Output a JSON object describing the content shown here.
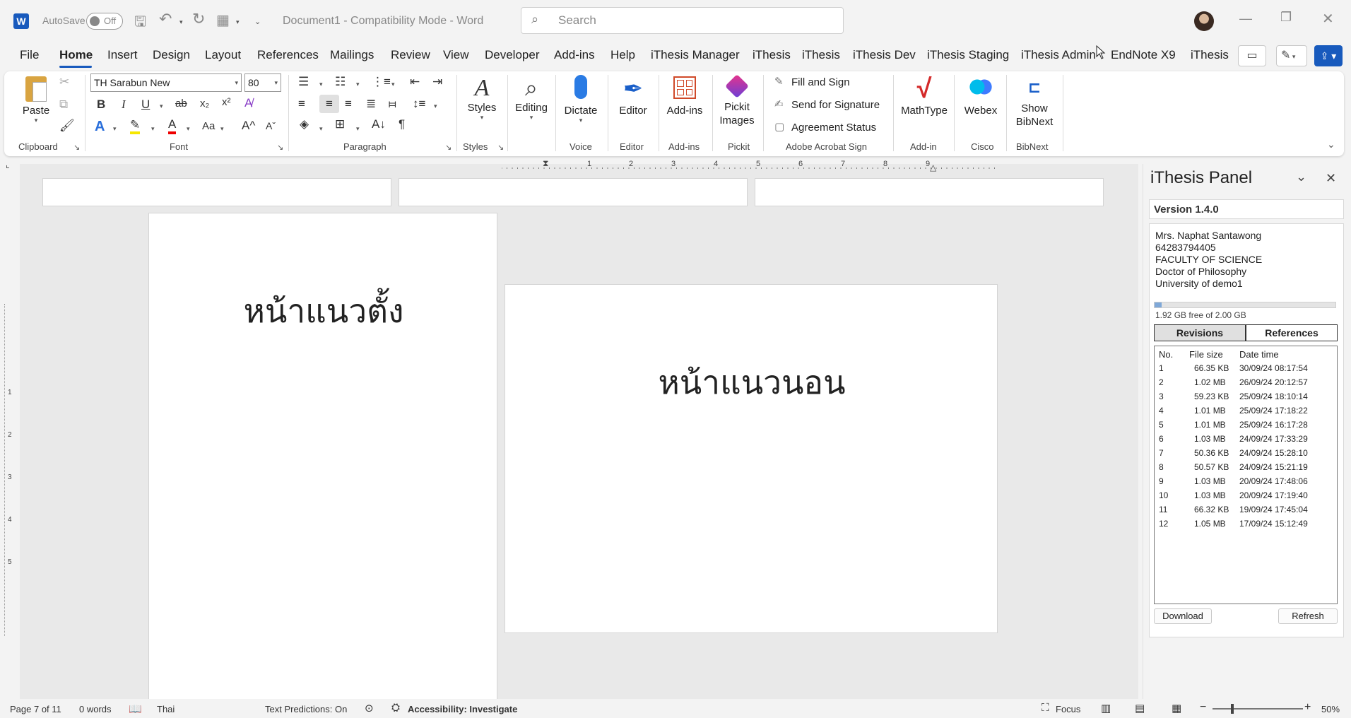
{
  "titlebar": {
    "autosave_label": "AutoSave",
    "autosave_state": "Off",
    "doc_title": "Document1  -  Compatibility Mode  -  Word",
    "search_placeholder": "Search"
  },
  "tabs": [
    "File",
    "Home",
    "Insert",
    "Design",
    "Layout",
    "References",
    "Mailings",
    "Review",
    "View",
    "Developer",
    "Add-ins",
    "Help",
    "iThesis Manager",
    "iThesis",
    "iThesis",
    "iThesis Dev",
    "iThesis Staging",
    "iThesis Admin",
    "EndNote X9",
    "iThesis"
  ],
  "ribbon": {
    "paste": "Paste",
    "font_name": "TH Sarabun New",
    "font_size": "80",
    "styles": "Styles",
    "editing": "Editing",
    "dictate": "Dictate",
    "editor": "Editor",
    "addins": "Add-ins",
    "pickit": "Pickit\nImages",
    "fill_sign": "Fill and Sign",
    "send_sig": "Send for Signature",
    "agreement": "Agreement Status",
    "mathtype": "MathType",
    "webex": "Webex",
    "show_bibnext": "Show\nBibNext",
    "groups": {
      "clipboard": "Clipboard",
      "font": "Font",
      "paragraph": "Paragraph",
      "styles": "Styles",
      "voice": "Voice",
      "editor": "Editor",
      "addins": "Add-ins",
      "pickit": "Pickit",
      "acrobat": "Adobe Acrobat Sign",
      "addin": "Add-in",
      "cisco": "Cisco",
      "bibnext": "BibNext"
    }
  },
  "document": {
    "portrait_text": "หน้าแนวตั้ง",
    "landscape_text": "หน้าแนวนอน",
    "ruler_numbers": [
      "1",
      "1",
      "2",
      "3",
      "4",
      "5",
      "6",
      "7",
      "8",
      "9"
    ],
    "vruler_numbers": [
      "1",
      "2",
      "3",
      "4",
      "5"
    ]
  },
  "panel": {
    "title": "iThesis Panel",
    "version": "Version 1.4.0",
    "user": {
      "name": "Mrs. Naphat Santawong",
      "id": "64283794405",
      "faculty": "FACULTY OF SCIENCE",
      "degree": "Doctor of Philosophy",
      "university": "University  of  demo1"
    },
    "storage_text": "1.92 GB free of 2.00 GB",
    "storage_used_fraction": 0.04,
    "tab_revisions": "Revisions",
    "tab_references": "References",
    "columns": [
      "No.",
      "File size",
      "Date time"
    ],
    "rows": [
      [
        "1",
        "66.35 KB",
        "30/09/24 08:17:54"
      ],
      [
        "2",
        "1.02 MB",
        "26/09/24 20:12:57"
      ],
      [
        "3",
        "59.23 KB",
        "25/09/24 18:10:14"
      ],
      [
        "4",
        "1.01 MB",
        "25/09/24 17:18:22"
      ],
      [
        "5",
        "1.01 MB",
        "25/09/24 16:17:28"
      ],
      [
        "6",
        "1.03 MB",
        "24/09/24 17:33:29"
      ],
      [
        "7",
        "50.36 KB",
        "24/09/24 15:28:10"
      ],
      [
        "8",
        "50.57 KB",
        "24/09/24 15:21:19"
      ],
      [
        "9",
        "1.03 MB",
        "20/09/24 17:48:06"
      ],
      [
        "10",
        "1.03 MB",
        "20/09/24 17:19:40"
      ],
      [
        "11",
        "66.32 KB",
        "19/09/24 17:45:04"
      ],
      [
        "12",
        "1.05 MB",
        "17/09/24 15:12:49"
      ]
    ],
    "download": "Download",
    "refresh": "Refresh"
  },
  "statusbar": {
    "page": "Page 7 of 11",
    "words": "0 words",
    "language": "Thai",
    "predictions": "Text Predictions: On",
    "accessibility": "Accessibility: Investigate",
    "focus": "Focus",
    "zoom": "50%"
  },
  "colors": {
    "accent": "#185abd",
    "word_blue": "#185abd"
  }
}
